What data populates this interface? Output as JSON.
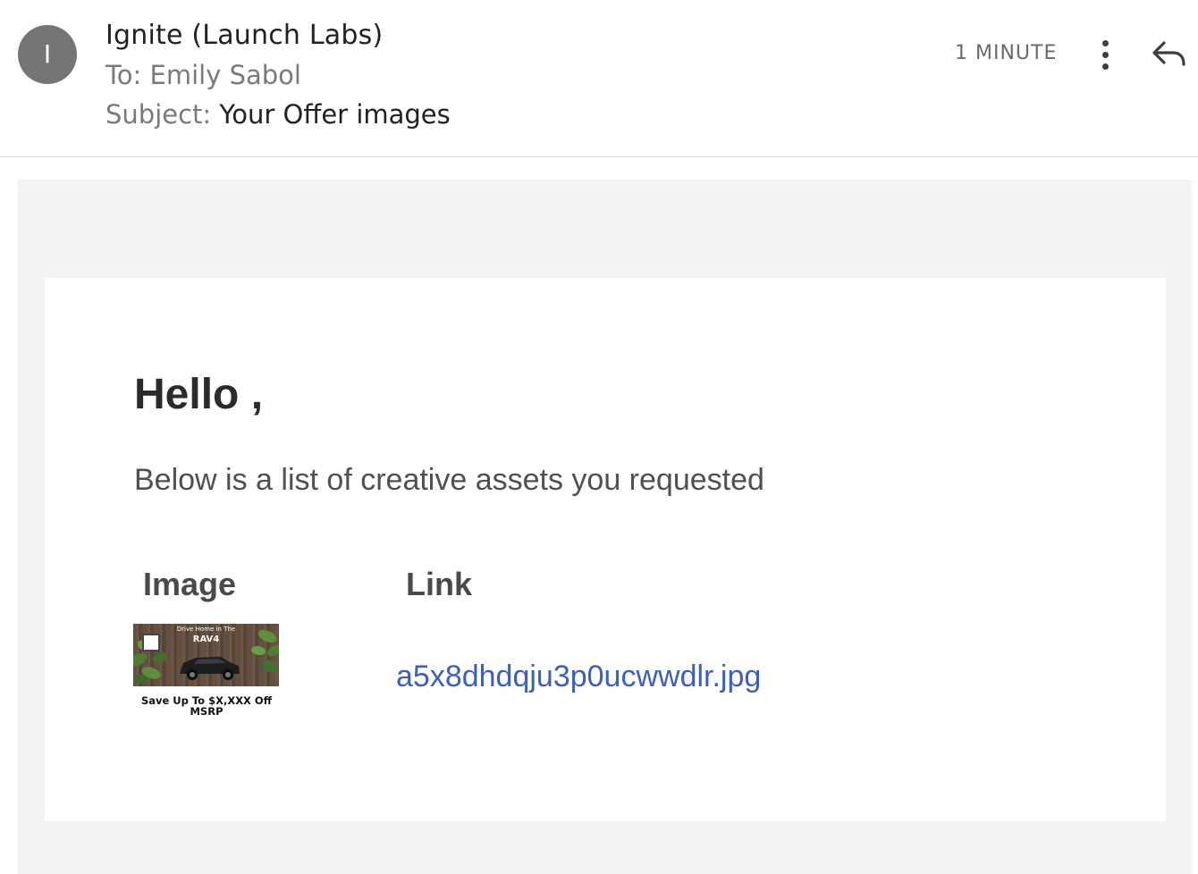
{
  "header": {
    "avatar_initial": "I",
    "sender": "Ignite (Launch Labs)",
    "to": "To: Emily Sabol",
    "subject_label": "Subject:",
    "subject": "Your Offer images",
    "time": "1 MINUTE",
    "icons": {
      "more": "more-vert-icon",
      "reply": "reply-icon"
    }
  },
  "body": {
    "greeting": "Hello ,",
    "intro": "Below is a list of creative assets you requested",
    "table": {
      "headers": [
        "Image",
        "Link"
      ],
      "rows": [
        {
          "thumbnail": {
            "tagline": "Drive Home in The",
            "model": "RAV4",
            "caption": "Save Up To $X,XXX Off MSRP"
          },
          "link": "a5x8dhdqju3p0ucwwdlr.jpg"
        }
      ]
    }
  },
  "colors": {
    "link": "#3b5fc0",
    "body_bg": "#f2f3f5",
    "avatar": "#757575"
  }
}
